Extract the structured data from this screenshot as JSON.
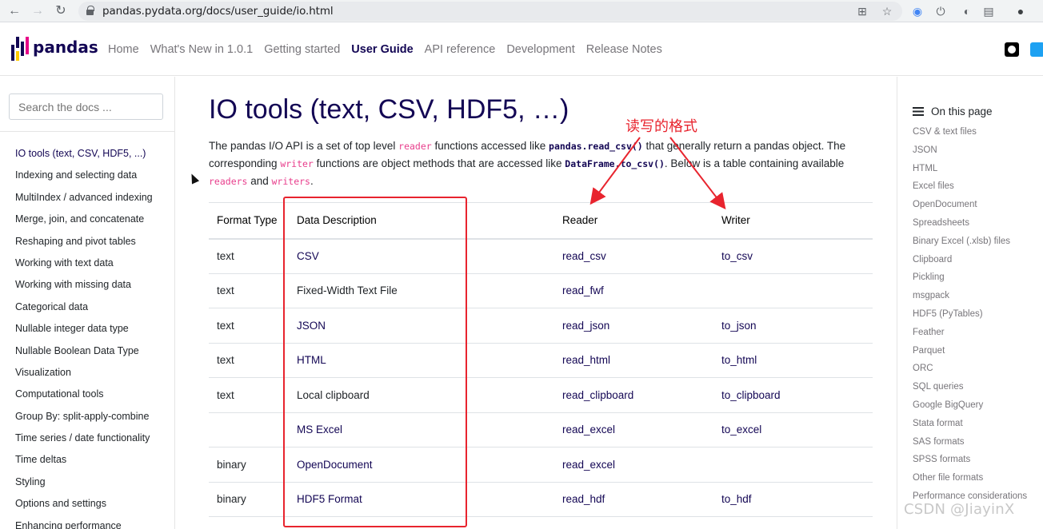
{
  "browser": {
    "url": "pandas.pydata.org/docs/user_guide/io.html"
  },
  "header": {
    "logo_text": "pandas",
    "nav": [
      "Home",
      "What's New in 1.0.1",
      "Getting started",
      "User Guide",
      "API reference",
      "Development",
      "Release Notes"
    ],
    "active_nav": "User Guide"
  },
  "sidebar": {
    "search_placeholder": "Search the docs ...",
    "items": [
      "IO tools (text, CSV, HDF5, ...)",
      "Indexing and selecting data",
      "MultiIndex / advanced indexing",
      "Merge, join, and concatenate",
      "Reshaping and pivot tables",
      "Working with text data",
      "Working with missing data",
      "Categorical data",
      "Nullable integer data type",
      "Nullable Boolean Data Type",
      "Visualization",
      "Computational tools",
      "Group By: split-apply-combine",
      "Time series / date functionality",
      "Time deltas",
      "Styling",
      "Options and settings",
      "Enhancing performance"
    ]
  },
  "main": {
    "title": "IO tools (text, CSV, HDF5, …)",
    "intro": {
      "t1": "The pandas I/O API is a set of top level ",
      "c1": "reader",
      "t2": " functions accessed like ",
      "c2": "pandas.read_csv()",
      "t3": " that generally return a pandas object. The corresponding ",
      "c3": "writer",
      "t4": " functions are object methods that are accessed like ",
      "c4": "DataFrame.to_csv()",
      "t5": ". Below is a table containing available ",
      "c5": "readers",
      "t6": " and ",
      "c6": "writers",
      "t7": "."
    },
    "table": {
      "headers": [
        "Format Type",
        "Data Description",
        "Reader",
        "Writer"
      ],
      "rows": [
        [
          "text",
          "CSV",
          "read_csv",
          "to_csv"
        ],
        [
          "text",
          "Fixed-Width Text File",
          "read_fwf",
          ""
        ],
        [
          "text",
          "JSON",
          "read_json",
          "to_json"
        ],
        [
          "text",
          "HTML",
          "read_html",
          "to_html"
        ],
        [
          "text",
          "Local clipboard",
          "read_clipboard",
          "to_clipboard"
        ],
        [
          "",
          "MS Excel",
          "read_excel",
          "to_excel"
        ],
        [
          "binary",
          "OpenDocument",
          "read_excel",
          ""
        ],
        [
          "binary",
          "HDF5 Format",
          "read_hdf",
          "to_hdf"
        ]
      ]
    }
  },
  "annotation": {
    "label": "读写的格式",
    "color": "#e8242e"
  },
  "toc": {
    "title": "On this page",
    "items": [
      "CSV & text files",
      "JSON",
      "HTML",
      "Excel files",
      "OpenDocument",
      "Spreadsheets",
      "Binary Excel (.xlsb) files",
      "Clipboard",
      "Pickling",
      "msgpack",
      "HDF5 (PyTables)",
      "Feather",
      "Parquet",
      "ORC",
      "SQL queries",
      "Google BigQuery",
      "Stata format",
      "SAS formats",
      "SPSS formats",
      "Other file formats",
      "Performance considerations"
    ]
  },
  "watermark": "CSDN @JiayinX",
  "colors": {
    "brand": "#130654",
    "code_pink": "#e83e8c"
  }
}
